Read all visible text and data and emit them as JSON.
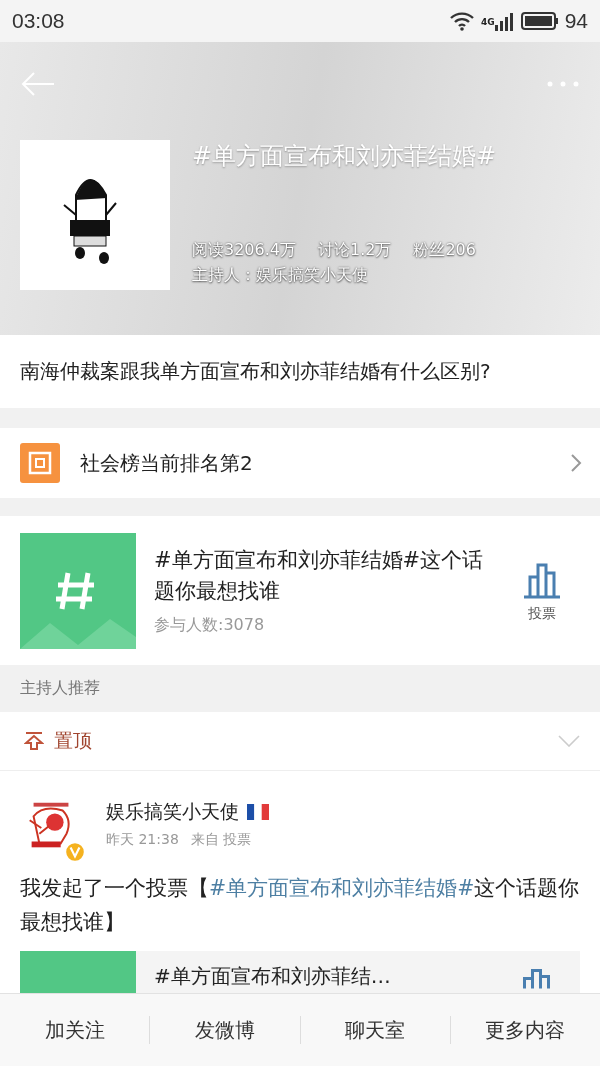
{
  "status_bar": {
    "time": "03:08",
    "network": "4G",
    "battery": "94"
  },
  "header": {
    "title": "#单方面宣布和刘亦菲结婚#",
    "stats": [
      "阅读3206.4万",
      "讨论1.2万",
      "粉丝206"
    ],
    "host": "主持人：娱乐搞笑小天使"
  },
  "question": "南海仲裁案跟我单方面宣布和刘亦菲结婚有什么区别?",
  "rank": {
    "text": "社会榜当前排名第2"
  },
  "vote_card": {
    "title": "#单方面宣布和刘亦菲结婚#这个话题你最想找谁",
    "participants": "参与人数:3078",
    "action": "投票"
  },
  "section_label": "主持人推荐",
  "pinned": {
    "label": "置顶"
  },
  "post": {
    "author": "娱乐搞笑小天使",
    "time": "昨天 21:38",
    "source": "来自 投票",
    "verified": true,
    "body": [
      {
        "kind": "text",
        "text": "我发起了一个投票【"
      },
      {
        "kind": "link",
        "text": "#单方面宣布和刘亦菲结婚#"
      },
      {
        "kind": "text",
        "text": "这个话题你最想找谁】"
      }
    ],
    "card_title": "#单方面宣布和刘亦菲结…"
  },
  "bottom_bar": [
    "加关注",
    "发微博",
    "聊天室",
    "更多内容"
  ]
}
